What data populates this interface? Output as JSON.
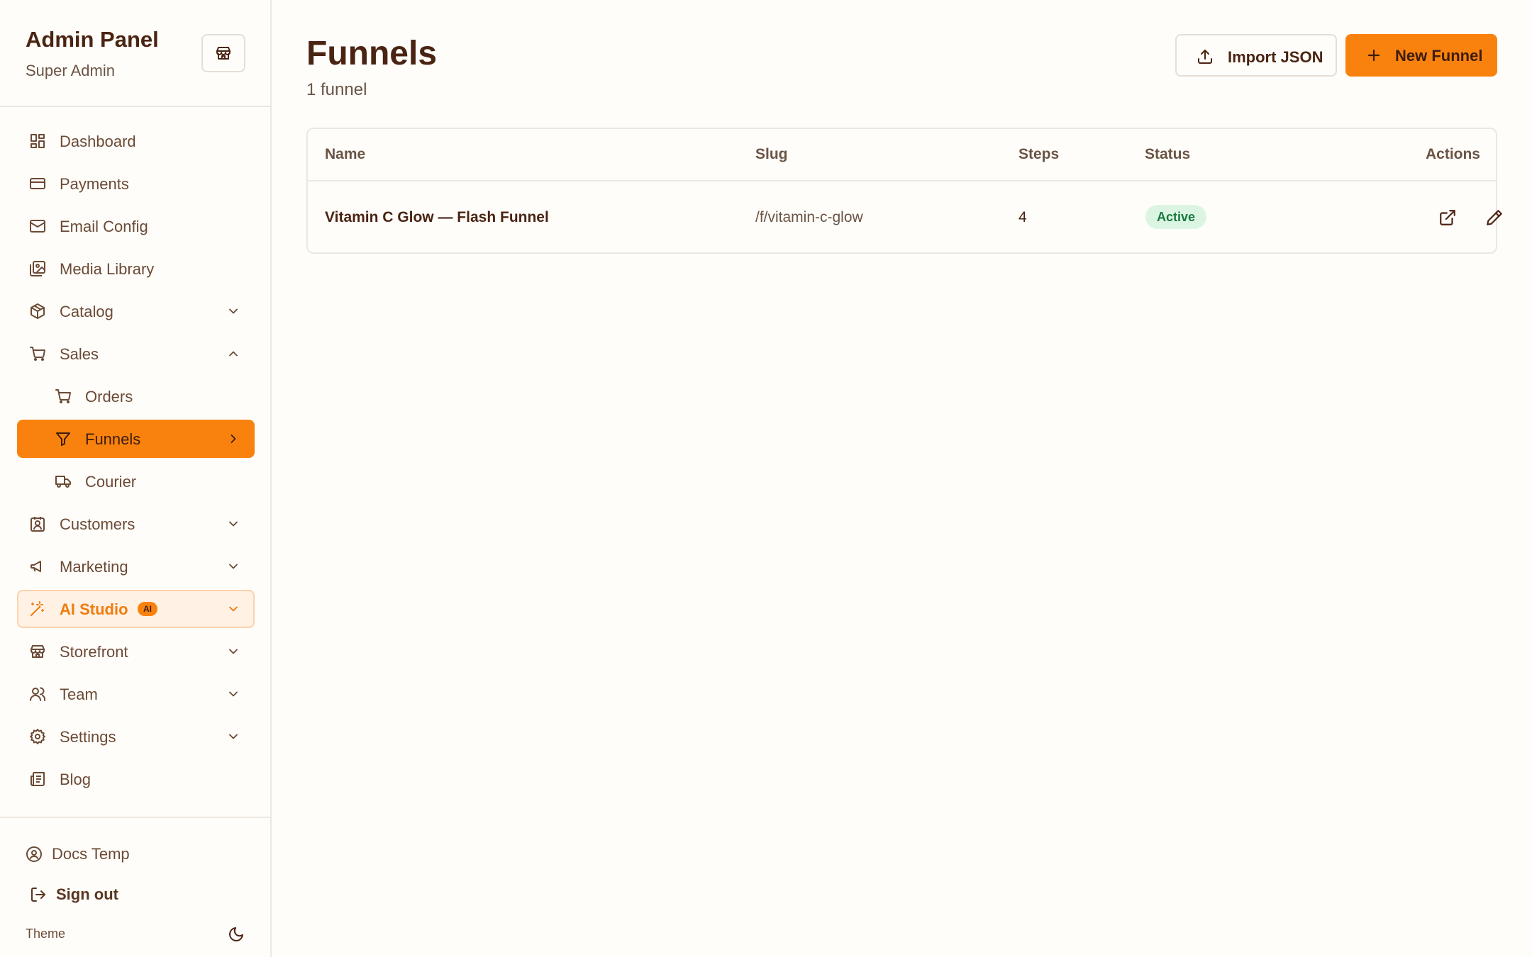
{
  "sidebar": {
    "brand_title": "Admin Panel",
    "brand_subtitle": "Super Admin",
    "store_button_icon": "store-icon",
    "items": [
      {
        "label": "Dashboard",
        "icon": "dashboard-icon"
      },
      {
        "label": "Payments",
        "icon": "credit-card-icon"
      },
      {
        "label": "Email Config",
        "icon": "mail-icon"
      },
      {
        "label": "Media Library",
        "icon": "images-icon"
      },
      {
        "label": "Catalog",
        "icon": "package-icon",
        "expanded": false
      },
      {
        "label": "Sales",
        "icon": "cart-icon",
        "expanded": true
      },
      {
        "label": "Orders",
        "icon": "cart-icon",
        "sub": true
      },
      {
        "label": "Funnels",
        "icon": "funnel-icon",
        "sub": true,
        "active": true
      },
      {
        "label": "Courier",
        "icon": "truck-icon",
        "sub": true
      },
      {
        "label": "Customers",
        "icon": "contact-icon",
        "expanded": false
      },
      {
        "label": "Marketing",
        "icon": "megaphone-icon",
        "expanded": false
      },
      {
        "label": "AI Studio",
        "icon": "wand-icon",
        "badge": "AI",
        "expanded": false
      },
      {
        "label": "Storefront",
        "icon": "store-icon",
        "expanded": false
      },
      {
        "label": "Team",
        "icon": "users-icon",
        "expanded": false
      },
      {
        "label": "Settings",
        "icon": "gear-icon",
        "expanded": false
      },
      {
        "label": "Blog",
        "icon": "newspaper-icon"
      }
    ],
    "footer": {
      "user_name": "Docs Temp",
      "sign_out_label": "Sign out",
      "theme_label": "Theme",
      "theme_icon": "moon-icon"
    }
  },
  "header": {
    "title": "Funnels",
    "subtitle": "1 funnel",
    "import_label": "Import JSON",
    "new_label": "New Funnel"
  },
  "table": {
    "columns": [
      "Name",
      "Slug",
      "Steps",
      "Status",
      "Actions"
    ],
    "rows": [
      {
        "name": "Vitamin C Glow — Flash Funnel",
        "slug": "/f/vitamin-c-glow",
        "steps": "4",
        "status": "Active"
      }
    ]
  },
  "colors": {
    "accent": "#f9820e",
    "text_dark": "#4a2412",
    "text_muted": "#6b5444",
    "status_active_bg": "#dcf5e3",
    "status_active_text": "#197a3e",
    "background": "#fffdfa"
  }
}
